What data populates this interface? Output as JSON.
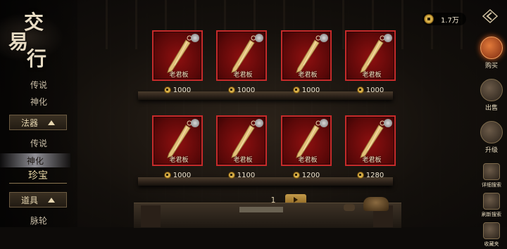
{
  "title": {
    "glyph_1": "交",
    "glyph_2": "易",
    "glyph_3": "行"
  },
  "currency": {
    "icon": "coin-icon",
    "amount": "1.7万"
  },
  "back_icon": "diamond-back-arrow-icon",
  "left_nav": {
    "top_items": [
      "传说",
      "神化"
    ],
    "category_faqi": "法器",
    "faqi_items": [
      "传说",
      "神化"
    ],
    "active_item": "神化",
    "category_zhenbao": "珍宝",
    "category_daoju": "道具",
    "bottom_item": "脉轮"
  },
  "right_menu": {
    "buy": "购买",
    "sell": "出售",
    "upgrade": "升级",
    "detailed_search": "详细搜索",
    "refresh_search": "刷新搜索",
    "favorites": "收藏夹"
  },
  "items": [
    {
      "name": "老君板",
      "price": "1000"
    },
    {
      "name": "老君板",
      "price": "1000"
    },
    {
      "name": "老君板",
      "price": "1000"
    },
    {
      "name": "老君板",
      "price": "1000"
    },
    {
      "name": "老君板",
      "price": "1000"
    },
    {
      "name": "老君板",
      "price": "1100"
    },
    {
      "name": "老君板",
      "price": "1200"
    },
    {
      "name": "老君板",
      "price": "1280"
    }
  ],
  "pager": {
    "page": "1"
  },
  "colors": {
    "item_bg": "#8e1010",
    "item_border": "#c72a2a",
    "gold": "#c39a4a"
  }
}
